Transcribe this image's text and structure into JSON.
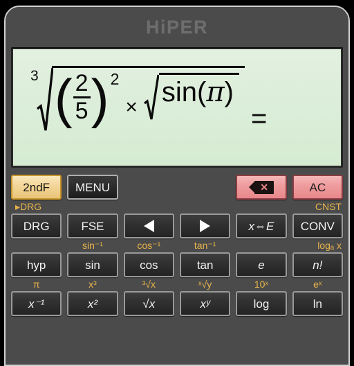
{
  "app": {
    "title": "HiPER"
  },
  "display": {
    "expression_text": "3√((2/5)² × √sin(π)) =",
    "root_index": "3",
    "paren_open": "(",
    "paren_close": ")",
    "fraction_numerator": "2",
    "fraction_denominator": "5",
    "exponent": "2",
    "multiply_symbol": "×",
    "function_name": "sin",
    "inner_paren_open": "(",
    "inner_argument": "π",
    "inner_paren_close": ")",
    "equals_symbol": "="
  },
  "colors": {
    "accent_gold": "#e8b44a",
    "display_bg": "#dceeda",
    "frame_bg": "#4b4b4b",
    "key_face": "#2f2f2f",
    "gold_key": "#f3d79a",
    "pink_key": "#ee9a9c"
  },
  "keypad": {
    "rows": [
      {
        "name": "row-control",
        "keys": [
          {
            "name": "second-function",
            "label": "2ndF",
            "style": "gold",
            "sub": "▸DRG",
            "sub_align": "left"
          },
          {
            "name": "menu",
            "label": "MENU",
            "style": "menu",
            "sub": ""
          },
          {
            "name": "spacer-1",
            "label": "",
            "style": "spacer",
            "sub": ""
          },
          {
            "name": "spacer-2",
            "label": "",
            "style": "spacer",
            "sub": ""
          },
          {
            "name": "backspace",
            "label": "",
            "style": "pink",
            "icon": "backspace-icon",
            "sub": ""
          },
          {
            "name": "all-clear",
            "label": "AC",
            "style": "pink",
            "sub": "CNST",
            "sub_align": "right"
          }
        ]
      },
      {
        "name": "row-mode",
        "keys": [
          {
            "name": "drg",
            "label": "DRG",
            "style": "dark",
            "sub": ""
          },
          {
            "name": "fse",
            "label": "FSE",
            "style": "dark",
            "sub": "sin⁻¹"
          },
          {
            "name": "cursor-left",
            "label": "",
            "style": "dark",
            "icon": "arrow-left-icon",
            "sub": "cos⁻¹"
          },
          {
            "name": "cursor-right",
            "label": "",
            "style": "dark",
            "icon": "arrow-right-icon",
            "sub": "tan⁻¹"
          },
          {
            "name": "x-exchange-e",
            "label": "x⇔E",
            "style": "dark",
            "sub": ""
          },
          {
            "name": "conv",
            "label": "CONV",
            "style": "dark",
            "sub": "logₐ x"
          }
        ]
      },
      {
        "name": "row-trig",
        "keys": [
          {
            "name": "hyp",
            "label": "hyp",
            "style": "dark",
            "sub": "π"
          },
          {
            "name": "sin",
            "label": "sin",
            "style": "dark",
            "sub": "x³"
          },
          {
            "name": "cos",
            "label": "cos",
            "style": "dark",
            "sub": "³√x"
          },
          {
            "name": "tan",
            "label": "tan",
            "style": "dark",
            "sub": "ˣ√y"
          },
          {
            "name": "euler-e",
            "label": "e",
            "style": "dark",
            "sub": "10ˣ"
          },
          {
            "name": "factorial",
            "label": "n!",
            "style": "dark",
            "sub": "eˣ"
          }
        ]
      },
      {
        "name": "row-power",
        "keys": [
          {
            "name": "reciprocal",
            "label": "x⁻¹",
            "style": "dark",
            "sub": ""
          },
          {
            "name": "square",
            "label": "x²",
            "style": "dark",
            "sub": ""
          },
          {
            "name": "square-root",
            "label": "√x",
            "style": "dark",
            "sub": ""
          },
          {
            "name": "power-xy",
            "label": "xʸ",
            "style": "dark",
            "sub": ""
          },
          {
            "name": "log",
            "label": "log",
            "style": "dark",
            "sub": ""
          },
          {
            "name": "ln",
            "label": "ln",
            "style": "dark",
            "sub": ""
          }
        ]
      }
    ]
  }
}
